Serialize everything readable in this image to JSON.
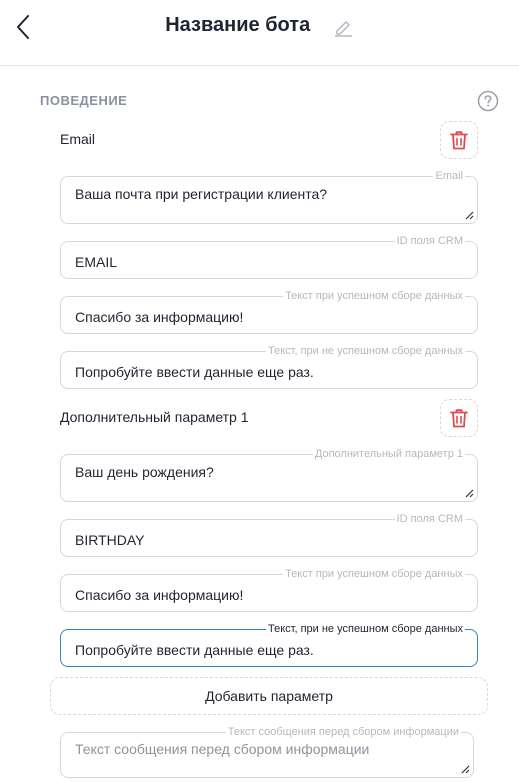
{
  "header": {
    "title": "Название бота",
    "back_icon": "chevron-left-icon",
    "edit_icon": "pencil-icon"
  },
  "section": {
    "title": "ПОВЕДЕНИЕ",
    "help_icon": "question-circle-icon"
  },
  "params": [
    {
      "title": "Email",
      "delete_icon": "trash-icon",
      "question": {
        "label": "Email",
        "value": "Ваша почта при регистрации клиента?"
      },
      "crm": {
        "label": "ID поля CRM",
        "value": "EMAIL"
      },
      "success": {
        "label": "Текст при успешном сборе данных",
        "value": "Спасибо за информацию!"
      },
      "fail": {
        "label": "Текст, при не успешном сборе данных",
        "value": "Попробуйте ввести данные еще раз."
      }
    },
    {
      "title": "Дополнительный параметр 1",
      "delete_icon": "trash-icon",
      "question": {
        "label": "Дополнительный параметр 1",
        "value": "Ваш день рождения?"
      },
      "crm": {
        "label": "ID поля CRM",
        "value": "BIRTHDAY"
      },
      "success": {
        "label": "Текст при успешном сборе данных",
        "value": "Спасибо за информацию!"
      },
      "fail": {
        "label": "Текст, при не успешном сборе данных",
        "value": "Попробуйте ввести данные еще раз."
      }
    }
  ],
  "add_button": {
    "label": "Добавить параметр"
  },
  "pre_message": {
    "label": "Текст сообщения перед сбором информации",
    "placeholder": "Текст сообщения перед сбором информации"
  },
  "colors": {
    "accent": "#2c89b5",
    "danger": "#e5484d",
    "muted": "#8a90a0",
    "border": "#d4d7dd"
  }
}
